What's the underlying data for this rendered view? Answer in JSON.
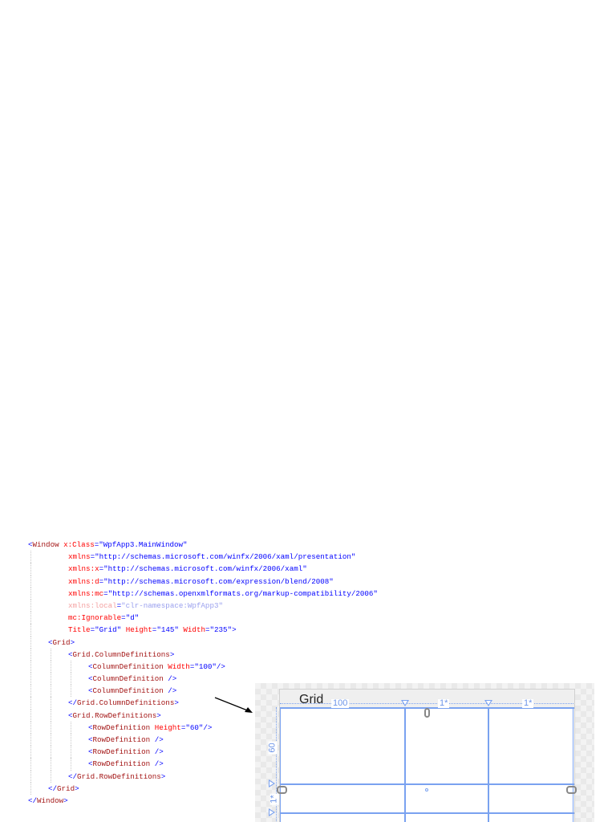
{
  "code": [
    {
      "indent": 0,
      "fade": false,
      "tokens": [
        [
          "b",
          "<"
        ],
        [
          "e",
          "Window"
        ],
        [
          "t",
          " "
        ],
        [
          "a",
          "x:Class"
        ],
        [
          "b",
          "="
        ],
        [
          "v",
          "\"WpfApp3.MainWindow\""
        ]
      ]
    },
    {
      "indent": 2,
      "fade": false,
      "tokens": [
        [
          "a",
          "xmlns"
        ],
        [
          "b",
          "="
        ],
        [
          "v",
          "\"http://schemas.microsoft.com/winfx/2006/xaml/presentation\""
        ]
      ]
    },
    {
      "indent": 2,
      "fade": false,
      "tokens": [
        [
          "a",
          "xmlns:x"
        ],
        [
          "b",
          "="
        ],
        [
          "v",
          "\"http://schemas.microsoft.com/winfx/2006/xaml\""
        ]
      ]
    },
    {
      "indent": 2,
      "fade": false,
      "tokens": [
        [
          "a",
          "xmlns:d"
        ],
        [
          "b",
          "="
        ],
        [
          "v",
          "\"http://schemas.microsoft.com/expression/blend/2008\""
        ]
      ]
    },
    {
      "indent": 2,
      "fade": false,
      "tokens": [
        [
          "a",
          "xmlns:mc"
        ],
        [
          "b",
          "="
        ],
        [
          "v",
          "\"http://schemas.openxmlformats.org/markup-compatibility/2006\""
        ]
      ]
    },
    {
      "indent": 2,
      "fade": true,
      "tokens": [
        [
          "a",
          "xmlns:local"
        ],
        [
          "b",
          "="
        ],
        [
          "v",
          "\"clr-namespace:WpfApp3\""
        ]
      ]
    },
    {
      "indent": 2,
      "fade": false,
      "tokens": [
        [
          "a",
          "mc:Ignorable"
        ],
        [
          "b",
          "="
        ],
        [
          "v",
          "\"d\""
        ]
      ]
    },
    {
      "indent": 2,
      "fade": false,
      "tokens": [
        [
          "a",
          "Title"
        ],
        [
          "b",
          "="
        ],
        [
          "v",
          "\"Grid\""
        ],
        [
          "t",
          " "
        ],
        [
          "a",
          "Height"
        ],
        [
          "b",
          "="
        ],
        [
          "v",
          "\"145\""
        ],
        [
          "t",
          " "
        ],
        [
          "a",
          "Width"
        ],
        [
          "b",
          "="
        ],
        [
          "v",
          "\"235\""
        ],
        [
          "b",
          ">"
        ]
      ]
    },
    {
      "indent": 1,
      "fade": false,
      "tokens": [
        [
          "b",
          "<"
        ],
        [
          "e",
          "Grid"
        ],
        [
          "b",
          ">"
        ]
      ]
    },
    {
      "indent": 2,
      "fade": false,
      "tokens": [
        [
          "b",
          "<"
        ],
        [
          "e",
          "Grid.ColumnDefinitions"
        ],
        [
          "b",
          ">"
        ]
      ]
    },
    {
      "indent": 3,
      "fade": false,
      "tokens": [
        [
          "b",
          "<"
        ],
        [
          "e",
          "ColumnDefinition"
        ],
        [
          "t",
          " "
        ],
        [
          "a",
          "Width"
        ],
        [
          "b",
          "="
        ],
        [
          "v",
          "\"100\""
        ],
        [
          "b",
          "/>"
        ]
      ]
    },
    {
      "indent": 3,
      "fade": false,
      "tokens": [
        [
          "b",
          "<"
        ],
        [
          "e",
          "ColumnDefinition"
        ],
        [
          "t",
          " "
        ],
        [
          "b",
          "/>"
        ]
      ]
    },
    {
      "indent": 3,
      "fade": false,
      "tokens": [
        [
          "b",
          "<"
        ],
        [
          "e",
          "ColumnDefinition"
        ],
        [
          "t",
          " "
        ],
        [
          "b",
          "/>"
        ]
      ]
    },
    {
      "indent": 2,
      "fade": false,
      "tokens": [
        [
          "b",
          "</"
        ],
        [
          "e",
          "Grid.ColumnDefinitions"
        ],
        [
          "b",
          ">"
        ]
      ]
    },
    {
      "indent": 2,
      "fade": false,
      "tokens": [
        [
          "b",
          "<"
        ],
        [
          "e",
          "Grid.RowDefinitions"
        ],
        [
          "b",
          ">"
        ]
      ]
    },
    {
      "indent": 3,
      "fade": false,
      "tokens": [
        [
          "b",
          "<"
        ],
        [
          "e",
          "RowDefinition"
        ],
        [
          "t",
          " "
        ],
        [
          "a",
          "Height"
        ],
        [
          "b",
          "="
        ],
        [
          "v",
          "\"60\""
        ],
        [
          "b",
          "/>"
        ]
      ]
    },
    {
      "indent": 3,
      "fade": false,
      "tokens": [
        [
          "b",
          "<"
        ],
        [
          "e",
          "RowDefinition"
        ],
        [
          "t",
          " "
        ],
        [
          "b",
          "/>"
        ]
      ]
    },
    {
      "indent": 3,
      "fade": false,
      "tokens": [
        [
          "b",
          "<"
        ],
        [
          "e",
          "RowDefinition"
        ],
        [
          "t",
          " "
        ],
        [
          "b",
          "/>"
        ]
      ]
    },
    {
      "indent": 3,
      "fade": false,
      "tokens": [
        [
          "b",
          "<"
        ],
        [
          "e",
          "RowDefinition"
        ],
        [
          "t",
          " "
        ],
        [
          "b",
          "/>"
        ]
      ]
    },
    {
      "indent": 2,
      "fade": false,
      "tokens": [
        [
          "b",
          "</"
        ],
        [
          "e",
          "Grid.RowDefinitions"
        ],
        [
          "b",
          ">"
        ]
      ]
    },
    {
      "indent": 1,
      "fade": false,
      "tokens": [
        [
          "b",
          "</"
        ],
        [
          "e",
          "Grid"
        ],
        [
          "b",
          ">"
        ]
      ]
    },
    {
      "indent": 0,
      "fade": false,
      "tokens": [
        [
          "b",
          "</"
        ],
        [
          "e",
          "Window"
        ],
        [
          "b",
          ">"
        ]
      ]
    }
  ],
  "designer": {
    "window_title": "Grid",
    "column_labels": [
      "100",
      "1*",
      "1*"
    ],
    "row_labels": [
      "60",
      "1*"
    ],
    "accent": "#7aa2f0"
  }
}
